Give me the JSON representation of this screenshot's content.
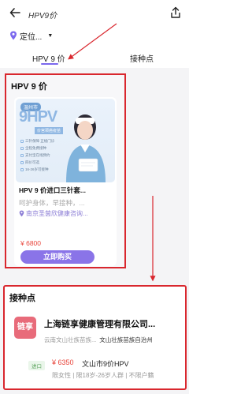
{
  "header": {
    "search_text": "HPV9价"
  },
  "location": {
    "label": "定位..."
  },
  "tabs": [
    {
      "label": "HPV 9 价"
    },
    {
      "label": "接种点"
    }
  ],
  "hpv_section": {
    "title": "HPV 9 价",
    "card": {
      "image": {
        "city_badge": "温州市",
        "big_text": "9HPV",
        "sub_text": "价宫颈癌疫苗",
        "bullets": [
          "三针保障 正规门诊",
          "全程免费接种",
          "支付宝在线预约",
          "四价可选",
          "16-26岁可接种"
        ]
      },
      "name": "HPV 9 价进口三针套...",
      "desc": "呵护身体，早接种，...",
      "address": "南京圣茵欣健康咨询...",
      "price": "¥ 6800",
      "buy_label": "立即购买"
    }
  },
  "site_section": {
    "title": "接种点",
    "site": {
      "logo_text": "链享",
      "name": "上海链享健康管理有限公司...",
      "addr_left": "云南文山壮族苗族...",
      "addr_right": "文山壮族苗族自治州",
      "tag": "进口",
      "price": "¥ 6350",
      "vaccine": "文山市9价HPV",
      "limits": "限女性 | 限18岁-26岁人群 | 不限户籍"
    }
  },
  "colors": {
    "accent_purple": "#8a74e8",
    "price_red": "#e8443a",
    "annotation_red": "#d9272e"
  }
}
